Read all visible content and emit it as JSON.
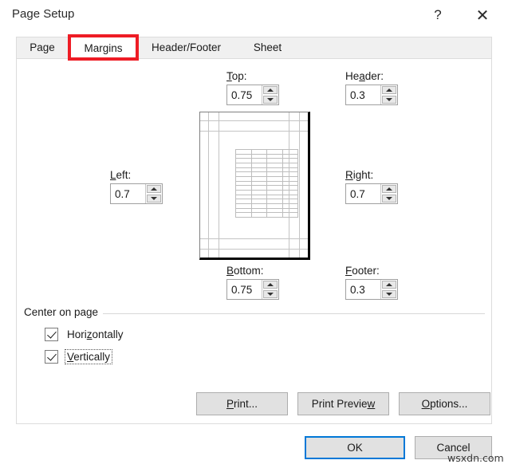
{
  "window": {
    "title": "Page Setup",
    "help_icon": "question-mark-icon",
    "close_icon": "close-icon"
  },
  "tabs": [
    {
      "id": "page",
      "label": "Page",
      "selected": false
    },
    {
      "id": "margins",
      "label": "Margins",
      "selected": true
    },
    {
      "id": "hf",
      "label": "Header/Footer",
      "selected": false
    },
    {
      "id": "sheet",
      "label": "Sheet",
      "selected": false
    }
  ],
  "annotation": {
    "target": "Margins",
    "color": "#ee1c25",
    "shape": "rectangle-outline"
  },
  "margins": {
    "top": {
      "label": "Top:",
      "accel": "T",
      "value": "0.75"
    },
    "header": {
      "label": "Header:",
      "accel": "a",
      "value": "0.3"
    },
    "left": {
      "label": "Left:",
      "accel": "L",
      "value": "0.7"
    },
    "right": {
      "label": "Right:",
      "accel": "R",
      "value": "0.7"
    },
    "bottom": {
      "label": "Bottom:",
      "accel": "B",
      "value": "0.75"
    },
    "footer": {
      "label": "Footer:",
      "accel": "F",
      "value": "0.3"
    }
  },
  "preview": {
    "grid_columns": 4,
    "grid_rows": 15
  },
  "center_on_page": {
    "title": "Center on page",
    "horizontally": {
      "label": "Horizontally",
      "checked": true,
      "accel": "z"
    },
    "vertically": {
      "label": "Vertically",
      "checked": true,
      "accel": "V",
      "focused": true
    }
  },
  "buttons": {
    "print": {
      "label": "Print...",
      "accel": "P"
    },
    "print_preview": {
      "label": "Print Preview",
      "accel": "w"
    },
    "options": {
      "label": "Options...",
      "accel": "O"
    },
    "ok": {
      "label": "OK",
      "default": true,
      "focus_color": "#0078d7"
    },
    "cancel": {
      "label": "Cancel"
    }
  },
  "watermark": {
    "text": "wsxdn.com"
  }
}
